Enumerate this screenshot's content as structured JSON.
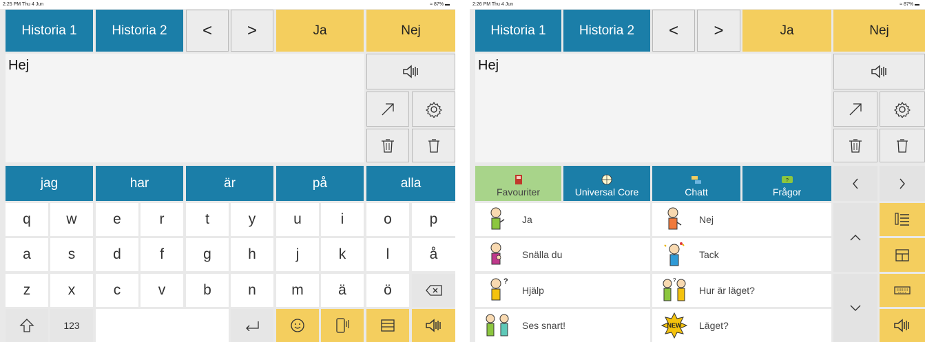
{
  "status_left": {
    "time": "2:25 PM  Thu 4 Jun",
    "battery": "87%"
  },
  "status_right": {
    "time": "2:26 PM  Thu 4 Jun",
    "battery": "87%"
  },
  "top_bar": {
    "history1": "Historia 1",
    "history2": "Historia 2",
    "prev": "<",
    "next": ">",
    "yes": "Ja",
    "no": "Nej"
  },
  "message": {
    "text": "Hej"
  },
  "predictions": [
    "jag",
    "har",
    "är",
    "på",
    "alla"
  ],
  "keyboard": {
    "row1": [
      "q",
      "w",
      "e",
      "r",
      "t",
      "y",
      "u",
      "i",
      "o",
      "p"
    ],
    "row2": [
      "a",
      "s",
      "d",
      "f",
      "g",
      "h",
      "j",
      "k",
      "l",
      "å"
    ],
    "row3": [
      "z",
      "x",
      "c",
      "v",
      "b",
      "n",
      "m",
      "ä",
      "ö"
    ],
    "numbers_label": "123"
  },
  "categories": [
    {
      "label": "Favouriter",
      "icon": "book-icon"
    },
    {
      "label": "Universal Core",
      "icon": "globe-icon"
    },
    {
      "label": "Chatt",
      "icon": "chat-icon"
    },
    {
      "label": "Frågor",
      "icon": "question-bubble-icon"
    }
  ],
  "phrases": [
    {
      "label": "Ja",
      "icon": "person-yes-icon"
    },
    {
      "label": "Nej",
      "icon": "person-no-icon"
    },
    {
      "label": "Snälla du",
      "icon": "person-please-icon"
    },
    {
      "label": "Tack",
      "icon": "person-thanks-icon"
    },
    {
      "label": "Hjälp",
      "icon": "person-help-icon"
    },
    {
      "label": "Hur är läget?",
      "icon": "people-question-icon"
    },
    {
      "label": "Ses snart!",
      "icon": "people-bye-icon"
    },
    {
      "label": "Läget?",
      "icon": "new-badge-icon"
    }
  ],
  "colors": {
    "blue": "#1b7ea8",
    "yellow": "#f4ce5e",
    "green": "#a8d48a",
    "grey": "#ececec"
  }
}
